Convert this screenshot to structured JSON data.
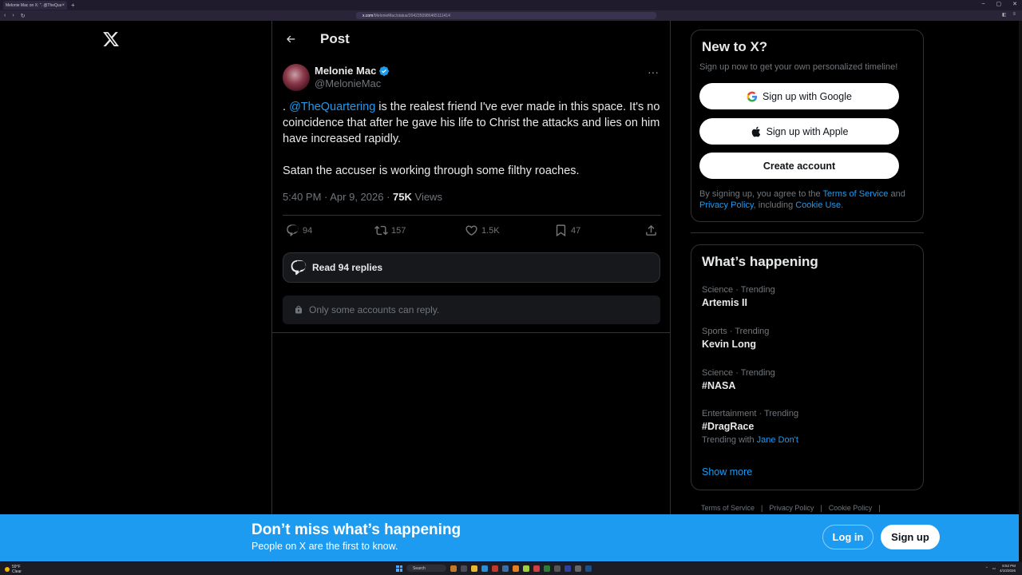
{
  "browser": {
    "tab_title": "Melonie Mac on X: \". @TheQuar",
    "tab_close": "×",
    "new_tab": "+",
    "url_host": "x.com",
    "url_path": "/MelonieMac/status/2042350986465111414"
  },
  "sidebar_left": {
    "logo_icon": "x-logo-icon"
  },
  "header": {
    "title": "Post"
  },
  "tweet": {
    "author_name": "Melonie Mac",
    "author_handle": "@MelonieMac",
    "text_prefix": ". ",
    "mention": "@TheQuartering",
    "text_rest": " is the realest friend I've ever made in this space. It's no coincidence that after he gave his life to Christ the attacks and lies on him have increased rapidly.",
    "paragraph2": "Satan the accuser is working through some filthy roaches.",
    "timestamp": "5:40 PM · Apr 9, 2026 · ",
    "views_count": "75K",
    "views_label": " Views",
    "replies": "94",
    "reposts": "157",
    "likes": "1.5K",
    "bookmarks": "47",
    "more": "···",
    "read_replies": "Read 94 replies",
    "reply_restriction": "Only some accounts can reply."
  },
  "signup_box": {
    "title": "New to X?",
    "subtitle": "Sign up now to get your own personalized timeline!",
    "google": "Sign up with Google",
    "apple": "Sign up with Apple",
    "create": "Create account",
    "legal_pre": "By signing up, you agree to the ",
    "terms": "Terms of Service",
    "legal_and": " and ",
    "privacy": "Privacy Policy",
    "legal_inc": ", including ",
    "cookie": "Cookie Use",
    "legal_end": "."
  },
  "trends": {
    "title": "What’s happening",
    "items": [
      {
        "category": "Science · Trending",
        "name": "Artemis II"
      },
      {
        "category": "Sports · Trending",
        "name": "Kevin Long"
      },
      {
        "category": "Science · Trending",
        "name": "#NASA"
      },
      {
        "category": "Entertainment · Trending",
        "name": "#DragRace",
        "with_label": "Trending with",
        "with_link": "Jane Don't"
      }
    ],
    "show_more": "Show more"
  },
  "footer": {
    "links": [
      "Terms of Service",
      "Privacy Policy",
      "Cookie Policy"
    ],
    "sep": "|"
  },
  "banner": {
    "title": "Don’t miss what’s happening",
    "subtitle": "People on X are the first to know.",
    "login": "Log in",
    "signup": "Sign up"
  },
  "taskbar": {
    "weather_temp": "59°F",
    "weather_desc": "Clear",
    "search": "Search",
    "time": "8:52 PM",
    "date": "4/10/2026"
  },
  "colors": {
    "accent": "#1d9bf0",
    "background": "#000000",
    "border": "#2f3336",
    "muted_text": "#71767b"
  }
}
